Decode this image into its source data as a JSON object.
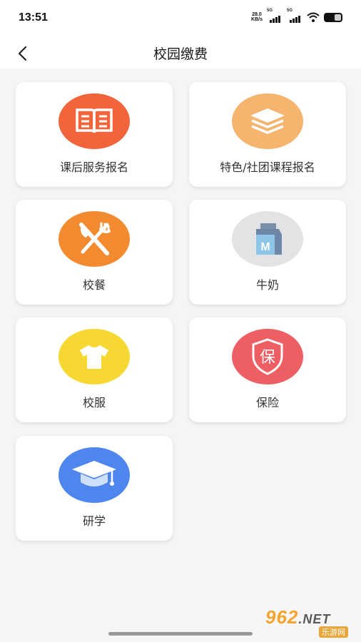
{
  "status_bar": {
    "time": "13:51",
    "net_speed_value": "28.0",
    "net_speed_unit": "KB/s",
    "signal1_label": "5G",
    "signal2_label": "5G",
    "icons": [
      "signal-icon",
      "signal-icon",
      "wifi-icon",
      "battery-icon"
    ]
  },
  "header": {
    "title": "校园缴费",
    "back_icon": "chevron-left-icon"
  },
  "tiles": [
    {
      "label": "课后服务报名",
      "icon": "book-icon",
      "color": "#f2643c"
    },
    {
      "label": "特色/社团课程报名",
      "icon": "layers-icon",
      "color": "#f5b56e"
    },
    {
      "label": "校餐",
      "icon": "knife-fork-icon",
      "color": "#f28a30"
    },
    {
      "label": "牛奶",
      "icon": "milk-carton-icon",
      "color": "#e3e3e6"
    },
    {
      "label": "校服",
      "icon": "tshirt-icon",
      "color": "#f7d732"
    },
    {
      "label": "保险",
      "icon": "shield-icon",
      "color": "#ee5f63"
    },
    {
      "label": "研学",
      "icon": "graduation-cap-icon",
      "color": "#4f86ee"
    }
  ],
  "watermark": {
    "brand": "962",
    "net": ".NET",
    "sub": "乐游网"
  }
}
